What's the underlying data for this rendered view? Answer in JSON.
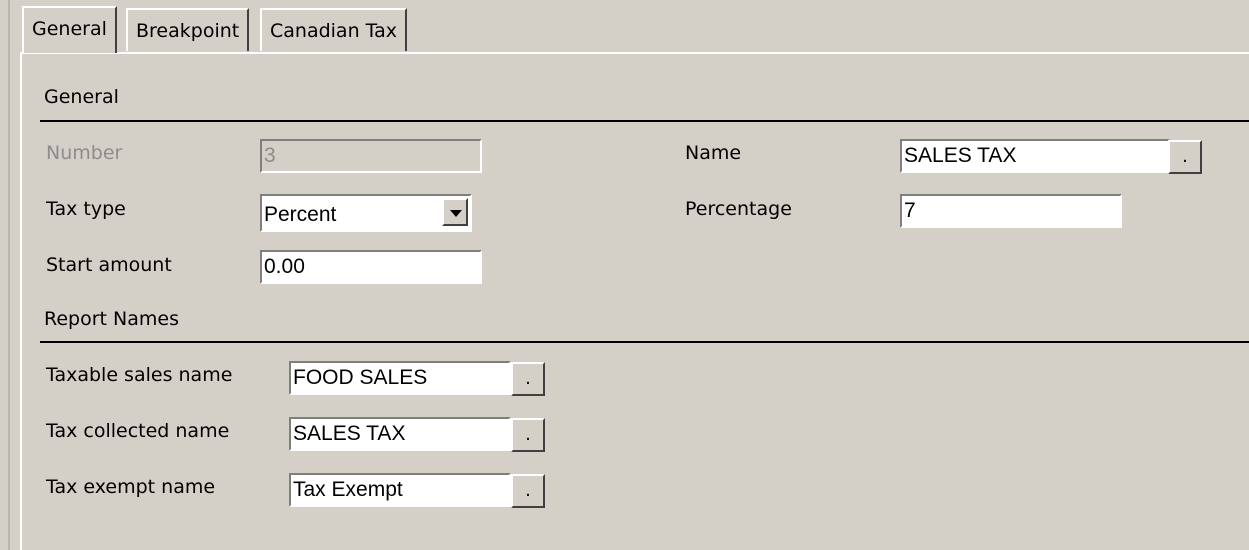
{
  "tabs": [
    "General",
    "Breakpoint",
    "Canadian Tax"
  ],
  "sections": {
    "general": "General",
    "report_names": "Report Names"
  },
  "general": {
    "number_label": "Number",
    "number_value": "3",
    "tax_type_label": "Tax type",
    "tax_type_value": "Percent",
    "start_amount_label": "Start amount",
    "start_amount_value": "0.00",
    "name_label": "Name",
    "name_value": "SALES TAX",
    "percentage_label": "Percentage",
    "percentage_value": "7"
  },
  "report_names": {
    "taxable_sales_label": "Taxable sales name",
    "taxable_sales_value": "FOOD SALES",
    "tax_collected_label": "Tax collected name",
    "tax_collected_value": "SALES TAX",
    "tax_exempt_label": "Tax exempt name",
    "tax_exempt_value": "Tax Exempt"
  },
  "lookup_button_label": ".",
  "icons": {
    "dropdown": "chevron-down-icon"
  }
}
